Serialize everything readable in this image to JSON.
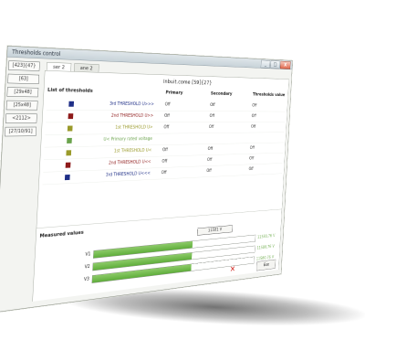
{
  "window": {
    "title": "Thresholds control",
    "controls": {
      "minimize": "_",
      "maximize": "□",
      "close": "X"
    }
  },
  "sidebar": {
    "buttons": [
      "[423]{47}",
      "[63]",
      "[29x48]",
      "[25x48]",
      "<2112>",
      "[27/10/91]"
    ]
  },
  "tabs": [
    {
      "label": "ser 2",
      "active": true
    },
    {
      "label": "ane 2",
      "active": false
    }
  ],
  "page_title": "Inbuit.come  [59]{27}",
  "thresholds": {
    "section_title": "List of thresholds",
    "columns": {
      "primary": "Primary",
      "secondary": "Secondary",
      "value": "Thresholds value"
    },
    "rows": [
      {
        "color": "#1f2f87",
        "label": "3rd THRESHOLD U>>>",
        "label_color": "#1f2f87",
        "primary": "Off",
        "secondary": "Off",
        "value": "Off"
      },
      {
        "color": "#8e1a1a",
        "label": "2nd THRESHOLD U>>",
        "label_color": "#8e1a1a",
        "primary": "Off",
        "secondary": "Off",
        "value": "Off"
      },
      {
        "color": "#9a9a2a",
        "label": "1st THRESHOLD U>",
        "label_color": "#9a9a2a",
        "primary": "Off",
        "secondary": "Off",
        "value": "Off"
      },
      {
        "color": "#6aa34c",
        "label": "U< Primary rated voltage",
        "label_color": "#6aa34c",
        "primary": "",
        "secondary": "",
        "value": ""
      },
      {
        "color": "#9a9a2a",
        "label": "1st THRESHOLD U<",
        "label_color": "#9a9a2a",
        "primary": "Off",
        "secondary": "Off",
        "value": "Off"
      },
      {
        "color": "#8e1a1a",
        "label": "2nd THRESHOLD U<<",
        "label_color": "#8e1a1a",
        "primary": "Off",
        "secondary": "Off",
        "value": "Off"
      },
      {
        "color": "#1f2f87",
        "label": "3rd THRESHOLD U<<<",
        "label_color": "#1f2f87",
        "primary": "Off",
        "secondary": "Off",
        "value": "Off"
      }
    ]
  },
  "measured": {
    "title": "Measured values",
    "box_value": "11581 V",
    "bars": [
      {
        "label": "V1",
        "fill_percent": 58,
        "value": "11580,76 V"
      },
      {
        "label": "V2",
        "fill_percent": 58,
        "value": "11580,76 V"
      },
      {
        "label": "V3",
        "fill_percent": 58,
        "value": "11580,76 V"
      }
    ]
  },
  "footer": {
    "close_icon": "✕",
    "button_label": "Exe"
  }
}
